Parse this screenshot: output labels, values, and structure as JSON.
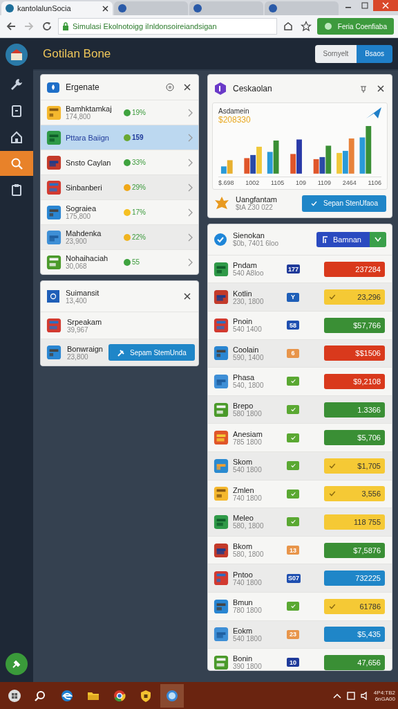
{
  "browser": {
    "tabs": [
      {
        "title": "kantolalunSocia",
        "selected": true
      },
      {
        "selected": false
      },
      {
        "selected": false
      },
      {
        "selected": false
      }
    ],
    "url": "Simulasi Ekolnotoigg iInldonsoireiandsigan",
    "action_button": "Feria Coenfiaba"
  },
  "app": {
    "title": "Gotilan Bone",
    "segments": [
      {
        "label": "Sornyelt",
        "selected": false
      },
      {
        "label": "Bsaos",
        "selected": true
      }
    ]
  },
  "sidebar": {
    "items": [
      {
        "kind": "wrench",
        "selected": false
      },
      {
        "kind": "square",
        "selected": false
      },
      {
        "kind": "home",
        "selected": false
      },
      {
        "kind": "search",
        "selected": true
      },
      {
        "kind": "clipboard",
        "selected": false
      }
    ]
  },
  "list_card": {
    "title": "Ergenate",
    "items": [
      {
        "name": "Bamhktamkaj",
        "sub": "174,800",
        "badge": "19%",
        "color": "#3fa33f",
        "selected": false
      },
      {
        "name": "Pttara Baiign",
        "badge": "159",
        "color": "#6aa832",
        "selected": true
      },
      {
        "name": "Snsto Caylan",
        "badge": "33%",
        "color": "#3fa33f",
        "selected": false
      },
      {
        "name": "Sinbanberi",
        "badge": "29%",
        "color": "#f0a818",
        "selected": false
      },
      {
        "name": "Sograiea",
        "sub": "175,800",
        "badge": "17%",
        "color": "#f5c023",
        "selected": false
      },
      {
        "name": "Mahdenka",
        "sub": "23,900",
        "badge": "22%",
        "color": "#f0b420",
        "selected": false
      },
      {
        "name": "Nohaihaciah",
        "sub": "30,068",
        "badge": "55",
        "color": "#3fa33f",
        "selected": false
      }
    ]
  },
  "summary_card": {
    "title": "Suimansit",
    "subtitle": "13,400",
    "items": [
      {
        "name": "Srpeakam",
        "sub": "39,967"
      },
      {
        "name": "Bonwraign",
        "sub": "23,800"
      }
    ],
    "button": "Sepam StemUnda"
  },
  "chart_card": {
    "title": "Ceskaolan",
    "chart_title": "Asdamein",
    "total": "$208330",
    "x_labels": [
      "$.698",
      "1002",
      "1105",
      "109",
      "1109",
      "2464",
      "1106"
    ],
    "footer_title": "Uangfantam",
    "footer_sub": "$tA Z30 022",
    "button": "Sepan StenUfaoa"
  },
  "table_card": {
    "title": "Sienokan",
    "subtitle": "$0b, 7401 6loo",
    "button": "Bamnan",
    "rows": [
      {
        "name": "Pndam",
        "sub": "540 A8loo",
        "tag": {
          "kind": "text",
          "text": "177",
          "color": "#1f3a9a"
        },
        "value": "237284",
        "color": "#d9391c",
        "checked": false
      },
      {
        "name": "Kotlin",
        "sub": "230, 1800",
        "tag": {
          "kind": "text",
          "text": "Y",
          "color": "#1f5fb8"
        },
        "value": "23,296",
        "color": "#f5c935",
        "checked": true
      },
      {
        "name": "Pnoin",
        "sub": "540 1400",
        "tag": {
          "kind": "text",
          "text": "58",
          "color": "#1f4fb0"
        },
        "value": "$57,766",
        "color": "#3a8f35",
        "checked": false
      },
      {
        "name": "Coolain",
        "sub": "590, 1400",
        "tag": {
          "kind": "text",
          "text": "6",
          "color": "#e8954a"
        },
        "value": "$$1506",
        "color": "#d9391c",
        "checked": false
      },
      {
        "name": "Phasa",
        "sub": "540, 1800",
        "tag": {
          "kind": "check",
          "color": "#5aa832"
        },
        "value": "$9,2108",
        "color": "#d9391c",
        "checked": false
      },
      {
        "name": "Brepo",
        "sub": "580 1800",
        "tag": {
          "kind": "check",
          "color": "#5aa832"
        },
        "value": "1.3366",
        "color": "#3a8f35",
        "checked": false
      },
      {
        "name": "Anesiam",
        "sub": "785 1800",
        "tag": {
          "kind": "check",
          "color": "#5aa832"
        },
        "value": "$5,706",
        "color": "#3a8f35",
        "checked": false
      },
      {
        "name": "Skom",
        "sub": "540 1800",
        "tag": {
          "kind": "check",
          "color": "#5aa832"
        },
        "value": "$1,705",
        "color": "#f5c935",
        "checked": true
      },
      {
        "name": "Zmlen",
        "sub": "740 1800",
        "tag": {
          "kind": "check",
          "color": "#5aa832"
        },
        "value": "3,556",
        "color": "#f5c935",
        "checked": true
      },
      {
        "name": "Meleo",
        "sub": "580, 1800",
        "tag": {
          "kind": "check",
          "color": "#5aa832"
        },
        "value": "118 755",
        "color": "#f5c935",
        "checked": false
      },
      {
        "name": "Bkom",
        "sub": "580, 1800",
        "tag": {
          "kind": "text",
          "text": "13",
          "color": "#e8954a"
        },
        "value": "$7,5876",
        "color": "#3a8f35",
        "checked": false
      },
      {
        "name": "Pntoo",
        "sub": "740 1800",
        "tag": {
          "kind": "text",
          "text": "S07",
          "color": "#1f4fb0"
        },
        "value": "732225",
        "color": "#1f86c8",
        "checked": false
      },
      {
        "name": "Bmun",
        "sub": "780 1800",
        "tag": {
          "kind": "check",
          "color": "#5aa832"
        },
        "value": "61786",
        "color": "#f5c935",
        "checked": true
      },
      {
        "name": "Eokm",
        "sub": "540 1800",
        "tag": {
          "kind": "text",
          "text": "23",
          "color": "#e8954a"
        },
        "value": "$5,435",
        "color": "#1f86c8",
        "checked": false
      },
      {
        "name": "Bonin",
        "sub": "390 1800",
        "tag": {
          "kind": "text",
          "text": "10",
          "color": "#1f3a9a"
        },
        "value": "47,656",
        "color": "#3a8f35",
        "checked": false
      }
    ]
  },
  "taskbar": {
    "apps": [
      {
        "kind": "search",
        "selected": false
      },
      {
        "kind": "browser",
        "selected": false
      },
      {
        "kind": "folder",
        "selected": false
      },
      {
        "kind": "chrome",
        "selected": false
      },
      {
        "kind": "shield",
        "selected": false
      },
      {
        "kind": "globe",
        "selected": true
      }
    ],
    "time": "4P4:TB2",
    "date": "6nGA00"
  }
}
